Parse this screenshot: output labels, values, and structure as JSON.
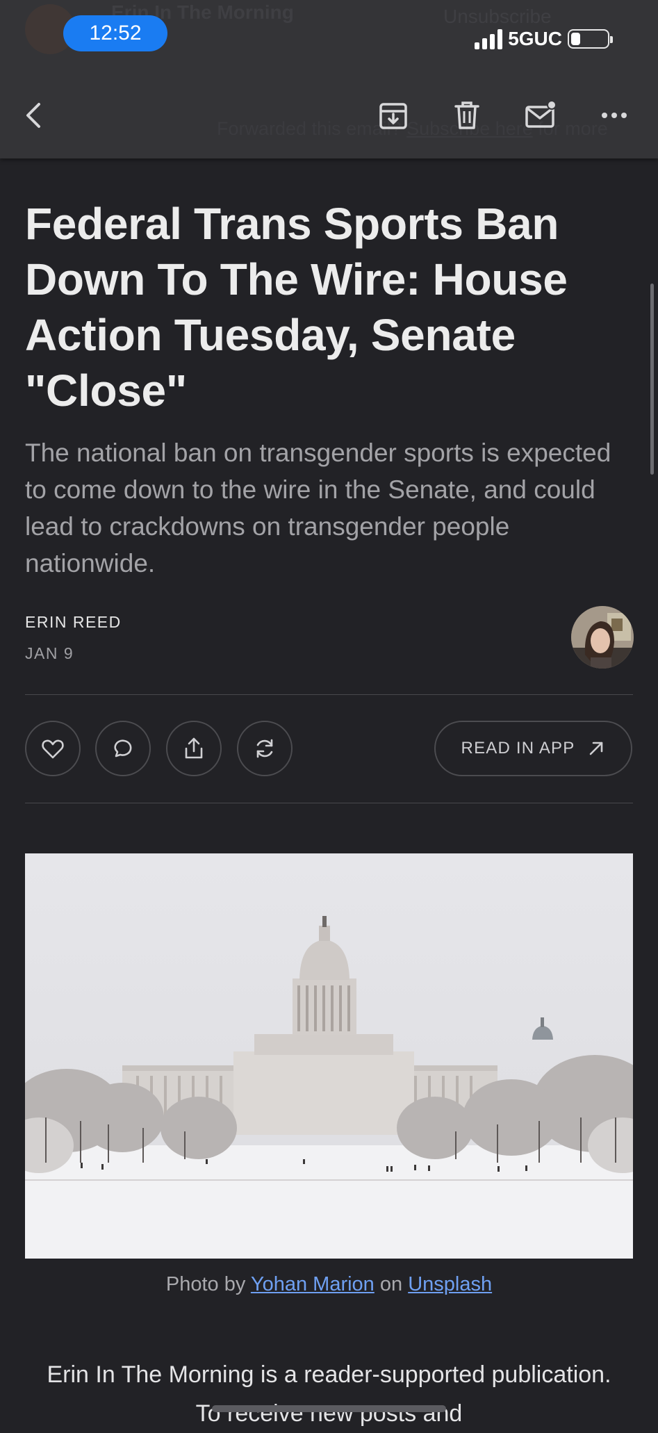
{
  "status_bar": {
    "time": "12:52",
    "network": "5GUC",
    "signal_bars": 4,
    "battery_level": 0.25
  },
  "ghost_header": {
    "sender": "Erin In The Morning",
    "unsubscribe": "Unsubscribe",
    "forwarded_prefix": "Forwarded this email?",
    "forwarded_link": "Subscribe here",
    "forwarded_suffix": "for more"
  },
  "toolbar": {
    "back_icon": "chevron-left-icon",
    "archive_icon": "archive-icon",
    "trash_icon": "trash-icon",
    "mark_unread_icon": "mail-unread-icon",
    "more_icon": "more-horizontal-icon"
  },
  "article": {
    "title": "Federal Trans Sports Ban Down To The Wire: House Action Tuesday, Senate \"Close\"",
    "subtitle": "The national ban on transgender sports is expected to come down to the wire in the Senate, and could lead to crackdowns on transgender people nationwide.",
    "author": "ERIN REED",
    "date": "JAN 9",
    "read_in_app": "READ IN APP",
    "caption": {
      "prefix": "Photo by",
      "photographer": "Yohan Marion",
      "middle": "on",
      "source": "Unsplash"
    },
    "body_start": "Erin In The Morning is a reader-supported publication. To receive new posts and"
  },
  "colors": {
    "background": "#222226",
    "topbar": "#343437",
    "accent_blue": "#1a7cf2",
    "link": "#6fa0f2"
  }
}
